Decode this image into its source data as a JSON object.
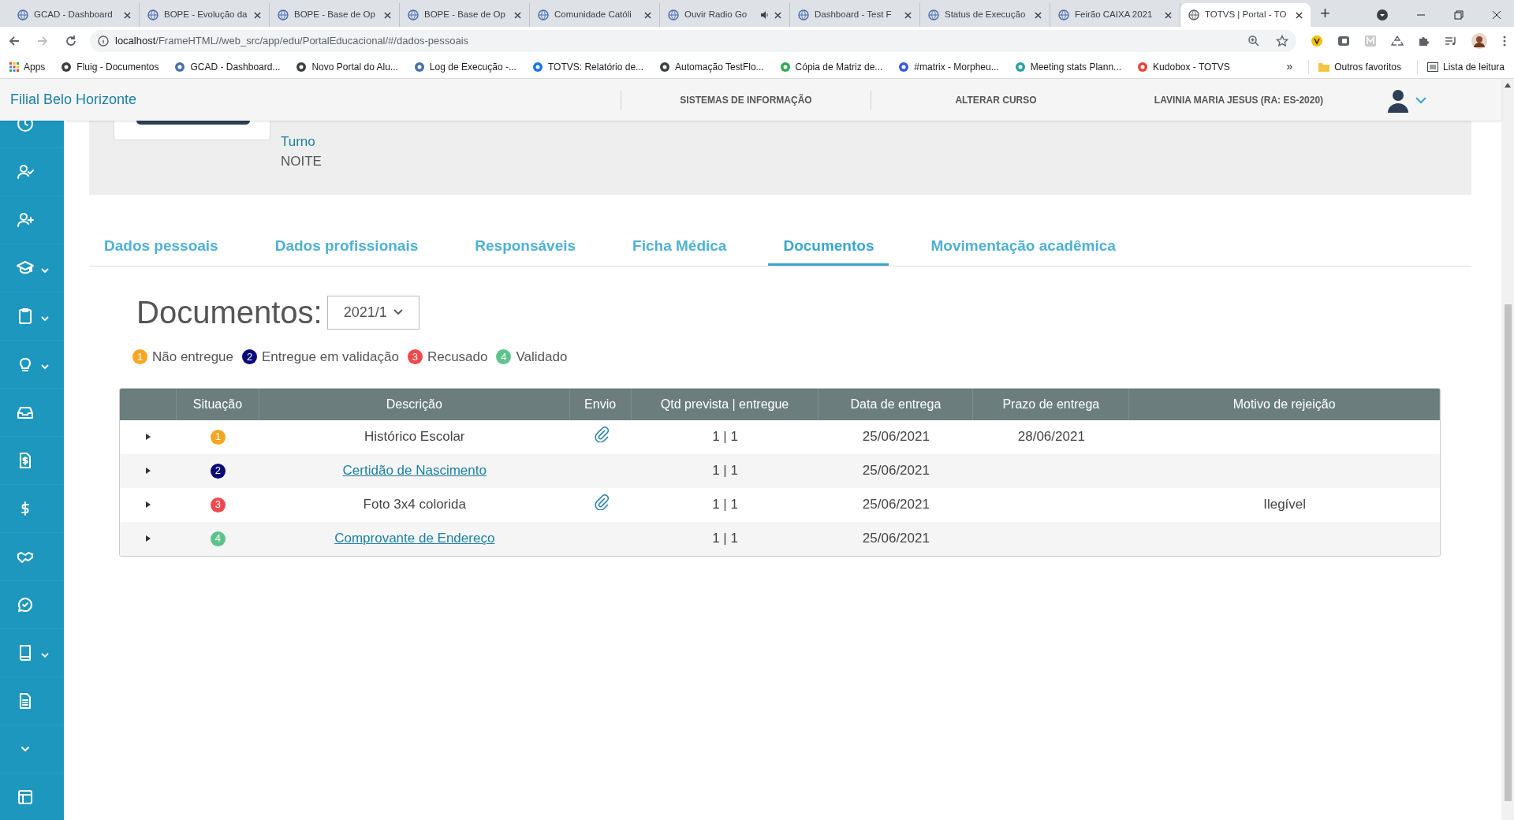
{
  "browser": {
    "tabs": [
      {
        "title": "GCAD - Dashboard",
        "selected": false,
        "audio": false
      },
      {
        "title": "BOPE - Evolução da",
        "selected": false,
        "audio": false
      },
      {
        "title": "BOPE - Base de Op",
        "selected": false,
        "audio": false
      },
      {
        "title": "BOPE - Base de Op",
        "selected": false,
        "audio": false
      },
      {
        "title": "Comunidade Católi",
        "selected": false,
        "audio": false
      },
      {
        "title": "Ouvir Radio Go",
        "selected": false,
        "audio": true
      },
      {
        "title": "Dashboard - Test F",
        "selected": false,
        "audio": false
      },
      {
        "title": "Status de Execução",
        "selected": false,
        "audio": false
      },
      {
        "title": "Feirão CAIXA 2021",
        "selected": false,
        "audio": false
      },
      {
        "title": "TOTVS | Portal - TO",
        "selected": true,
        "audio": false
      }
    ],
    "new_tab": "+",
    "address": {
      "host": "localhost",
      "path": "/FrameHTML//web_src/app/edu/PortalEducacional/#/dados-pessoais"
    },
    "bookmarks": [
      "Apps",
      "Fluig - Documentos",
      "GCAD - Dashboard...",
      "Novo Portal do Alu...",
      "Log de Execução -...",
      "TOTVS: Relatório de...",
      "Automação TestFlo...",
      "Cópia de Matriz de...",
      "#matrix - Morpheu...",
      "Meeting stats Plann...",
      "Kudobox - TOTVS"
    ],
    "more_bookmarks": "»",
    "other_bookmarks": "Outros favoritos",
    "reading_list": "Lista de leitura"
  },
  "header": {
    "branch": "Filial Belo Horizonte",
    "links": [
      "SISTEMAS DE INFORMAÇÃO",
      "ALTERAR CURSO",
      "LAVINIA MARIA JESUS (RA: ES-2020)"
    ]
  },
  "sidebar": {
    "items": [
      {
        "expandable": false
      },
      {
        "expandable": false
      },
      {
        "expandable": false
      },
      {
        "expandable": true
      },
      {
        "expandable": true
      },
      {
        "expandable": true
      },
      {
        "expandable": false
      },
      {
        "expandable": false
      },
      {
        "expandable": false
      },
      {
        "expandable": false
      },
      {
        "expandable": false
      },
      {
        "expandable": true
      },
      {
        "expandable": false
      },
      {
        "expandable": false
      },
      {
        "expandable": false
      }
    ]
  },
  "profile": {
    "label": "Turno",
    "value": "NOITE"
  },
  "tabs": [
    {
      "label": "Dados pessoais",
      "selected": false
    },
    {
      "label": "Dados profissionais",
      "selected": false
    },
    {
      "label": "Responsáveis",
      "selected": false
    },
    {
      "label": "Ficha Médica",
      "selected": false
    },
    {
      "label": "Documentos",
      "selected": true
    },
    {
      "label": "Movimentação acadêmica",
      "selected": false
    }
  ],
  "documents": {
    "title": "Documentos:",
    "period": "2021/1",
    "legend": [
      {
        "number": "1",
        "label": "Não entregue",
        "color": "#f5a623"
      },
      {
        "number": "2",
        "label": "Entregue em validação",
        "color": "#0a0a78"
      },
      {
        "number": "3",
        "label": "Recusado",
        "color": "#f0494c"
      },
      {
        "number": "4",
        "label": "Validado",
        "color": "#5cc38c"
      }
    ],
    "table": {
      "columns": [
        "Situação",
        "Descrição",
        "Envio",
        "Qtd prevista | entregue",
        "Data de entrega",
        "Prazo de entrega",
        "Motivo de rejeição"
      ],
      "rows": [
        {
          "status": "1",
          "color": "#f5a623",
          "description": "Histórico Escolar",
          "link": false,
          "attachment": true,
          "quantity": "1 | 1",
          "delivered": "25/06/2021",
          "deadline": "28/06/2021",
          "reason": ""
        },
        {
          "status": "2",
          "color": "#0a0a78",
          "description": "Certidão de Nascimento",
          "link": true,
          "attachment": false,
          "quantity": "1 | 1",
          "delivered": "25/06/2021",
          "deadline": "",
          "reason": ""
        },
        {
          "status": "3",
          "color": "#f0494c",
          "description": "Foto 3x4 colorida",
          "link": false,
          "attachment": true,
          "quantity": "1 | 1",
          "delivered": "25/06/2021",
          "deadline": "",
          "reason": "Ilegível"
        },
        {
          "status": "4",
          "color": "#5cc38c",
          "description": "Comprovante de Endereço",
          "link": true,
          "attachment": false,
          "quantity": "1 | 1",
          "delivered": "25/06/2021",
          "deadline": "",
          "reason": ""
        }
      ]
    }
  }
}
